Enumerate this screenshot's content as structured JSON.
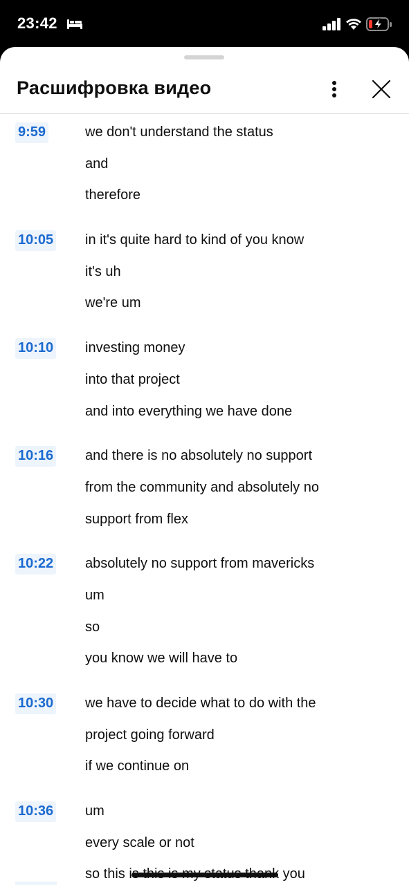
{
  "status_bar": {
    "time": "23:42",
    "icons": [
      "bed-icon",
      "cellular-signal-icon",
      "wifi-icon",
      "battery-low-charging-icon"
    ],
    "battery_color": "#ff3b30"
  },
  "sheet": {
    "title": "Расшифровка видео",
    "more_icon": "more-vertical-icon",
    "close_icon": "close-icon"
  },
  "colors": {
    "timestamp_text": "#1a6ad0",
    "timestamp_bg": "#eef4fc",
    "text": "#0f0f0f"
  },
  "transcript": [
    {
      "time": "9:59",
      "lines": [
        "we don't understand the status",
        "and",
        "therefore"
      ]
    },
    {
      "time": "10:05",
      "lines": [
        "in it's quite hard to kind of you know",
        "it's uh",
        "we're um"
      ]
    },
    {
      "time": "10:10",
      "lines": [
        "investing money",
        "into that project",
        "and into everything we have done"
      ]
    },
    {
      "time": "10:16",
      "lines": [
        "and there is no absolutely no support",
        "from the community and absolutely no",
        "support from flex"
      ]
    },
    {
      "time": "10:22",
      "lines": [
        "absolutely no support from mavericks",
        "um",
        "so",
        "you know we will have to"
      ]
    },
    {
      "time": "10:30",
      "lines": [
        "we have to decide what to do with the",
        "project going forward",
        "if we continue on"
      ]
    },
    {
      "time": "10:36",
      "lines": [
        "um",
        "every scale or not",
        "so this is this is my status thank you"
      ]
    }
  ]
}
